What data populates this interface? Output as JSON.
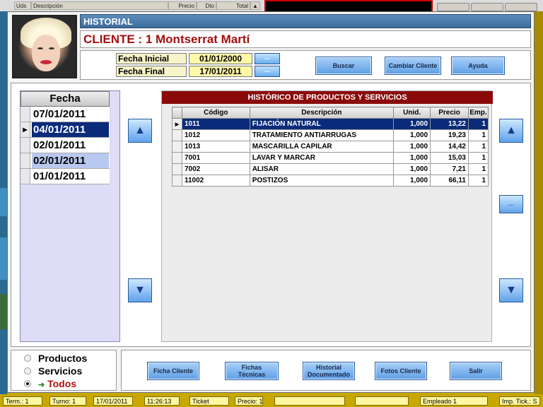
{
  "background": {
    "columns": [
      "Uds",
      "Descripción",
      "Precio",
      "Dto",
      "Total"
    ]
  },
  "header": {
    "title": "HISTORIAL",
    "client": "CLIENTE : 1 Montserrat Martí"
  },
  "filter": {
    "start_label": "Fecha Inicial",
    "start_value": "01/01/2000",
    "end_label": "Fecha Final",
    "end_value": "17/01/2011",
    "picker_label": "...",
    "search_button": "Buscar",
    "change_client_button": "Cambiar Cliente",
    "help_button": "Ayuda"
  },
  "dates": {
    "header": "Fecha",
    "items": [
      "07/01/2011",
      "04/01/2011",
      "02/01/2011",
      "02/01/2011",
      "01/01/2011"
    ],
    "selected_index": 1
  },
  "history": {
    "title": "HISTÓRICO DE PRODUCTOS Y SERVICIOS",
    "columns": [
      "Código",
      "Descripción",
      "Unid.",
      "Precio",
      "Emp."
    ],
    "rows": [
      [
        "1011",
        "FIJACIÓN NATURAL",
        "1,000",
        "13,22",
        "1"
      ],
      [
        "1012",
        "TRATAMIENTO ANTIARRUGAS",
        "1,000",
        "19,23",
        "1"
      ],
      [
        "1013",
        "MASCARILLA CAPILAR",
        "1,000",
        "14,42",
        "1"
      ],
      [
        "7001",
        "LAVAR Y MARCAR",
        "1,000",
        "15,03",
        "1"
      ],
      [
        "7002",
        "ALISAR",
        "1,000",
        "7,21",
        "1"
      ],
      [
        "11002",
        "POSTIZOS",
        "1,000",
        "66,11",
        "1"
      ]
    ],
    "more_label": "..."
  },
  "filter_type": {
    "options": [
      "Productos",
      "Servicios",
      "Todos"
    ],
    "selected": "Todos"
  },
  "actions": {
    "ficha_cliente": "Ficha Cliente",
    "fichas_tecnicas_1": "Fichas",
    "fichas_tecnicas_2": "Técnicas",
    "historial_doc_1": "Historial",
    "historial_doc_2": "Documentado",
    "fotos_cliente": "Fotos Cliente",
    "salir": "Salir"
  },
  "status": {
    "terminal": "Term.: 1",
    "turno": "Turno: 1",
    "date": "17/01/2011",
    "time": "11:26:13",
    "ticket": "Ticket",
    "precio": "Precio: 1",
    "empleado": "Empleado 1",
    "imp_tick": "Imp. Tick.: S"
  },
  "colors": {
    "accent": "#0a2a7a",
    "title_red": "#a01010",
    "table_header": "#8a0a0a",
    "frame": "#c8a800"
  }
}
